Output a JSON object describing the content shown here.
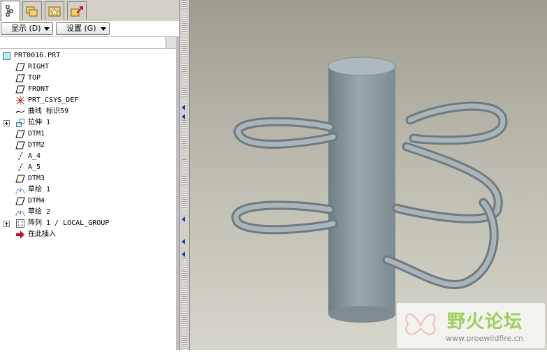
{
  "toolbar": {
    "show_label": "显示 (D)",
    "settings_label": "设置 (G)"
  },
  "tabs": [
    {
      "icon": "model-tree-icon"
    },
    {
      "icon": "folder-browser-icon"
    },
    {
      "icon": "favorites-icon"
    },
    {
      "icon": "connections-icon"
    }
  ],
  "tree": {
    "items": [
      {
        "label": "PRT0016.PRT",
        "icon": "part-icon"
      },
      {
        "label": "RIGHT",
        "icon": "datum-plane-icon"
      },
      {
        "label": "TOP",
        "icon": "datum-plane-icon"
      },
      {
        "label": "FRONT",
        "icon": "datum-plane-icon"
      },
      {
        "label": "PRT_CSYS_DEF",
        "icon": "coordinate-system-icon"
      },
      {
        "label": "曲线 标识59",
        "icon": "curve-icon"
      },
      {
        "label": "拉伸 1",
        "icon": "extrude-icon"
      },
      {
        "label": "DTM1",
        "icon": "datum-plane-icon"
      },
      {
        "label": "DTM2",
        "icon": "datum-plane-icon"
      },
      {
        "label": "A_4",
        "icon": "datum-axis-icon"
      },
      {
        "label": "A_5",
        "icon": "datum-axis-icon"
      },
      {
        "label": "DTM3",
        "icon": "datum-plane-icon"
      },
      {
        "label": "草绘 1",
        "icon": "sketch-icon"
      },
      {
        "label": "DTM4",
        "icon": "datum-plane-icon"
      },
      {
        "label": "草绘 2",
        "icon": "sketch-icon"
      },
      {
        "label": "阵列 1 / LOCAL_GROUP",
        "icon": "pattern-icon"
      },
      {
        "label": "在此插入",
        "icon": "insert-here-arrow-icon"
      }
    ]
  },
  "watermark": {
    "title": "野火论坛",
    "url": "www.proewildfire.cn"
  },
  "colors": {
    "part_gray": "#9aa7ad",
    "viewport_top": "#9f9c90",
    "viewport_bottom": "#d7d6cc",
    "insert_arrow": "#c0121a",
    "watermark_green": "#9ccf58"
  }
}
